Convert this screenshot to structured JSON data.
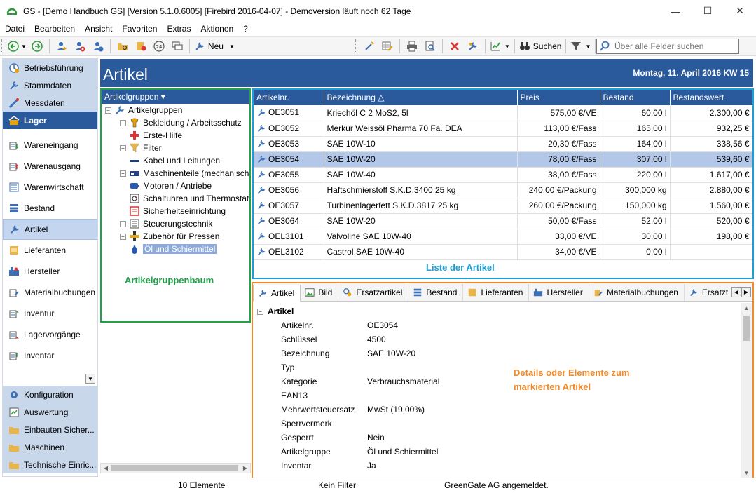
{
  "window": {
    "title": "GS - [Demo Handbuch GS]  [Version  5.1.0.6005]  [Firebird 2016-04-07] - Demoversion läuft noch 62 Tage",
    "minimize": "—",
    "maximize": "☐",
    "close": "✕"
  },
  "menu": [
    "Datei",
    "Bearbeiten",
    "Ansicht",
    "Favoriten",
    "Extras",
    "Aktionen",
    "?"
  ],
  "toolbar": {
    "new_label": "Neu",
    "search_label": "Suchen",
    "search_placeholder": "Über alle Felder suchen"
  },
  "nav": {
    "top": [
      "Betriebsführung",
      "Stammdaten",
      "Messdaten",
      "Lager"
    ],
    "mid": [
      "Wareneingang",
      "Warenausgang",
      "Warenwirtschaft",
      "Bestand",
      "Artikel",
      "Lieferanten",
      "Hersteller",
      "Materialbuchungen",
      "Inventur",
      "Lagervorgänge",
      "Inventar"
    ],
    "bottom": [
      "Konfiguration",
      "Auswertung",
      "Einbauten Sicher...",
      "Maschinen",
      "Technische Einric..."
    ]
  },
  "header": {
    "title": "Artikel",
    "date": "Montag, 11. April 2016  KW 15"
  },
  "tree": {
    "header": "Artikelgruppen ▾",
    "root": "Artikelgruppen",
    "items": [
      "Bekleidung / Arbeitsschutz",
      "Erste-Hilfe",
      "Filter",
      "Kabel und Leitungen",
      "Maschinenteile (mechanisch",
      "Motoren / Antriebe",
      "Schaltuhren und Thermostat",
      "Sicherheitseinrichtung",
      "Steuerungstechnik",
      "Zubehör für Pressen",
      "Öl und Schiermittel"
    ],
    "annotation": "Artikelgruppenbaum"
  },
  "list": {
    "columns": [
      "Artikelnr.",
      "Bezeichnung △",
      "Preis",
      "Bestand",
      "Bestandswert"
    ],
    "rows": [
      [
        "OE3051",
        "Kriechöl C 2 MoS2, 5l",
        "575,00 €/VE",
        "60,00 l",
        "2.300,00 €"
      ],
      [
        "OE3052",
        "Merkur Weissöl Pharma 70 Fa. DEA",
        "113,00 €/Fass",
        "165,00 l",
        "932,25 €"
      ],
      [
        "OE3053",
        "SAE 10W-10",
        "20,30 €/Fass",
        "164,00 l",
        "338,56 €"
      ],
      [
        "OE3054",
        "SAE 10W-20",
        "78,00 €/Fass",
        "307,00 l",
        "539,60 €"
      ],
      [
        "OE3055",
        "SAE 10W-40",
        "38,00 €/Fass",
        "220,00 l",
        "1.617,00 €"
      ],
      [
        "OE3056",
        "Haftschmierstoff S.K.D.3400 25 kg",
        "240,00 €/Packung",
        "300,000 kg",
        "2.880,00 €"
      ],
      [
        "OE3057",
        "Turbinenlagerfett S.K.D.3817 25 kg",
        "260,00 €/Packung",
        "150,000 kg",
        "1.560,00 €"
      ],
      [
        "OE3064",
        "SAE 10W-20",
        "50,00 €/Fass",
        "52,00 l",
        "520,00 €"
      ],
      [
        "OEL3101",
        "Valvoline SAE 10W-40",
        "33,00 €/VE",
        "30,00 l",
        "198,00 €"
      ],
      [
        "OEL3102",
        "Castrol SAE 10W-40",
        "34,00 €/VE",
        "0,00 l",
        ""
      ]
    ],
    "annotation": "Liste der Artikel"
  },
  "detail": {
    "tabs": [
      "Artikel",
      "Bild",
      "Ersatzartikel",
      "Bestand",
      "Lieferanten",
      "Hersteller",
      "Materialbuchungen",
      "Ersatzt"
    ],
    "group": "Artikel",
    "props": [
      [
        "Artikelnr.",
        "OE3054"
      ],
      [
        "Schlüssel",
        "4500"
      ],
      [
        "Bezeichnung",
        "SAE 10W-20"
      ],
      [
        "Typ",
        ""
      ],
      [
        "Kategorie",
        "Verbrauchsmaterial"
      ],
      [
        "EAN13",
        ""
      ],
      [
        "Mehrwertsteuersatz",
        "MwSt (19,00%)"
      ],
      [
        "Sperrvermerk",
        ""
      ],
      [
        "Gesperrt",
        "Nein"
      ],
      [
        "Artikelgruppe",
        "Öl und Schiermittel"
      ],
      [
        "Inventar",
        "Ja"
      ]
    ],
    "annotation_line1": "Details oder Elemente zum",
    "annotation_line2": "markierten Artikel"
  },
  "status": {
    "count": "10 Elemente",
    "filter": "Kein Filter",
    "user": "GreenGate AG angemeldet."
  },
  "colors": {
    "accent_blue": "#2a5a9c",
    "tree_border": "#21a14c",
    "list_border": "#1aa0d6",
    "detail_border": "#f08a2b"
  }
}
